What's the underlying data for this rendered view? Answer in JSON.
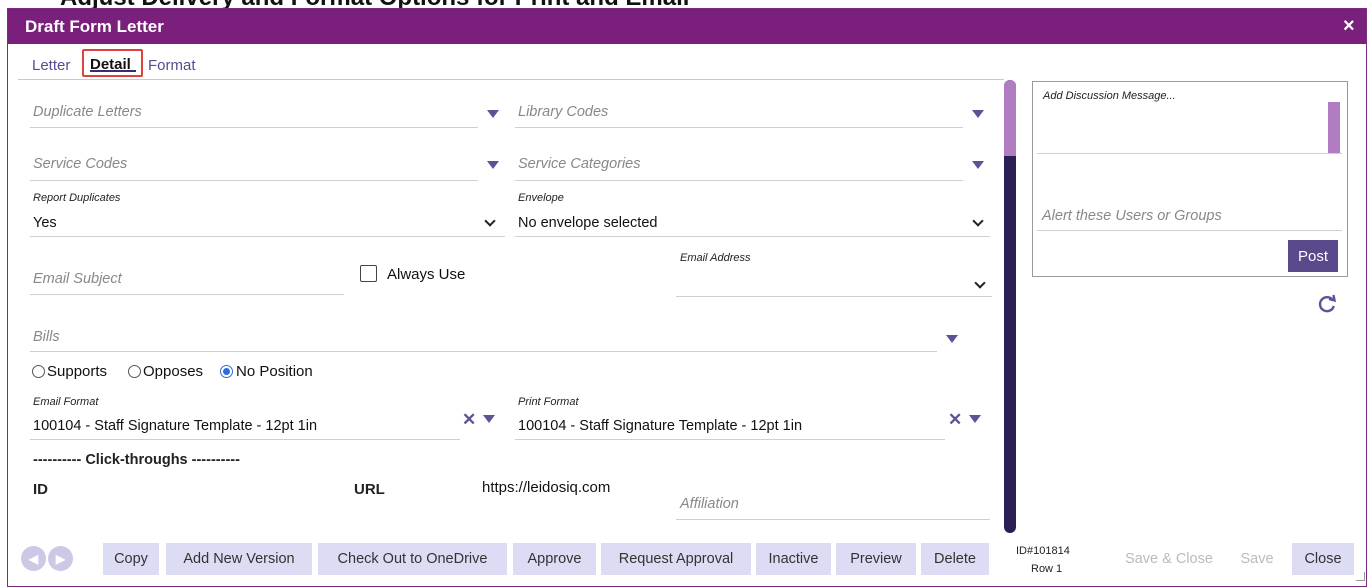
{
  "background_heading": "Adjust Delivery and Format Options for Print and Email",
  "dialog": {
    "title": "Draft Form Letter",
    "close_symbol": "×"
  },
  "tabs": [
    {
      "label": "Letter",
      "active": false
    },
    {
      "label": "Detail",
      "active": true
    },
    {
      "label": "Format",
      "active": false
    }
  ],
  "fields": {
    "duplicate_letters": {
      "placeholder": "Duplicate Letters"
    },
    "library_codes": {
      "placeholder": "Library Codes"
    },
    "service_codes": {
      "placeholder": "Service Codes"
    },
    "service_categories": {
      "placeholder": "Service Categories"
    },
    "report_duplicates": {
      "label": "Report Duplicates",
      "value": "Yes"
    },
    "envelope": {
      "label": "Envelope",
      "value": "No envelope selected"
    },
    "email_subject": {
      "placeholder": "Email Subject"
    },
    "always_use": {
      "label": "Always Use",
      "checked": false
    },
    "email_address": {
      "label": "Email Address",
      "value": ""
    },
    "bills": {
      "placeholder": "Bills"
    },
    "position": {
      "options": [
        "Supports",
        "Opposes",
        "No Position"
      ],
      "selected": "No Position"
    },
    "email_format": {
      "label": "Email Format",
      "value": "100104 - Staff Signature Template - 12pt 1in"
    },
    "print_format": {
      "label": "Print Format",
      "value": "100104 - Staff Signature Template - 12pt 1in"
    }
  },
  "clickthroughs": {
    "heading": "---------- Click-throughs ----------",
    "id_header": "ID",
    "url_header": "URL",
    "url_value": "https://leidosiq.com",
    "affiliation_placeholder": "Affiliation"
  },
  "discussion": {
    "message_placeholder": "Add Discussion Message...",
    "alert_placeholder": "Alert these Users or Groups",
    "post_label": "Post",
    "refresh_icon": "refresh-icon"
  },
  "footer": {
    "buttons": [
      "Copy",
      "Add New Version",
      "Check Out to OneDrive",
      "Approve",
      "Request Approval",
      "Inactive",
      "Preview",
      "Delete"
    ],
    "record_id": "ID#101814",
    "row_label": "Row 1",
    "save_close_label": "Save & Close",
    "save_label": "Save",
    "close_label": "Close"
  },
  "colors": {
    "title_bar": "#7b1f7c",
    "accent": "#5b5396",
    "button_bg": "#dcdcf4",
    "scroll_thumb": "#b07cc2",
    "scroll_track": "#2a1e55",
    "active_tab_outline": "#e04040"
  }
}
